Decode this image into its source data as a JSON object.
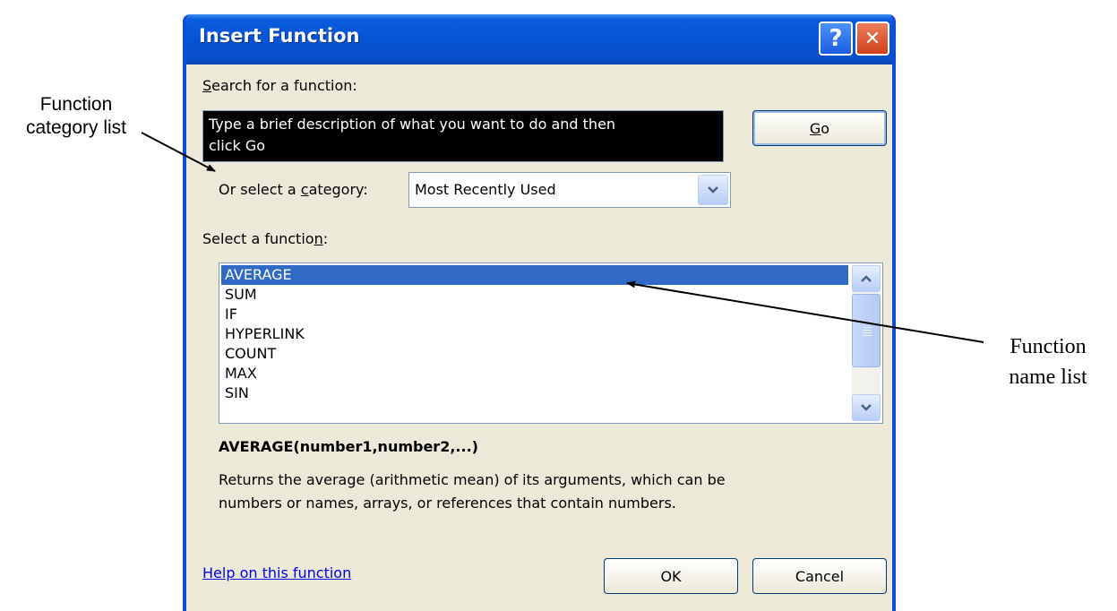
{
  "annotations": {
    "category_list_line1": "Function",
    "category_list_line2": "category list",
    "name_list_line1": "Function",
    "name_list_line2": "name list"
  },
  "dialog": {
    "title": "Insert Function",
    "help_glyph": "?",
    "close_glyph": "✕"
  },
  "search": {
    "label_prefix": "",
    "label_mnemonic": "S",
    "label_rest": "earch for a function:",
    "value_line1": "Type a brief description of what you want to do and then",
    "value_line2": "click Go",
    "go_mnemonic": "G",
    "go_rest": "o"
  },
  "category": {
    "label_prefix": "Or select a ",
    "label_mnemonic": "c",
    "label_rest": "ategory:",
    "selected": "Most Recently Used"
  },
  "function_list": {
    "label_prefix": "Select a functio",
    "label_mnemonic": "n",
    "label_rest": ":",
    "items": [
      "AVERAGE",
      "SUM",
      "IF",
      "HYPERLINK",
      "COUNT",
      "MAX",
      "SIN"
    ],
    "selected_index": 0
  },
  "details": {
    "syntax": "AVERAGE(number1,number2,...)",
    "description_line1": "Returns the average (arithmetic mean) of its arguments, which can be",
    "description_line2": "numbers or names, arrays, or references that contain numbers."
  },
  "footer": {
    "help_link": "Help on this function",
    "ok_label": "OK",
    "cancel_label": "Cancel"
  }
}
